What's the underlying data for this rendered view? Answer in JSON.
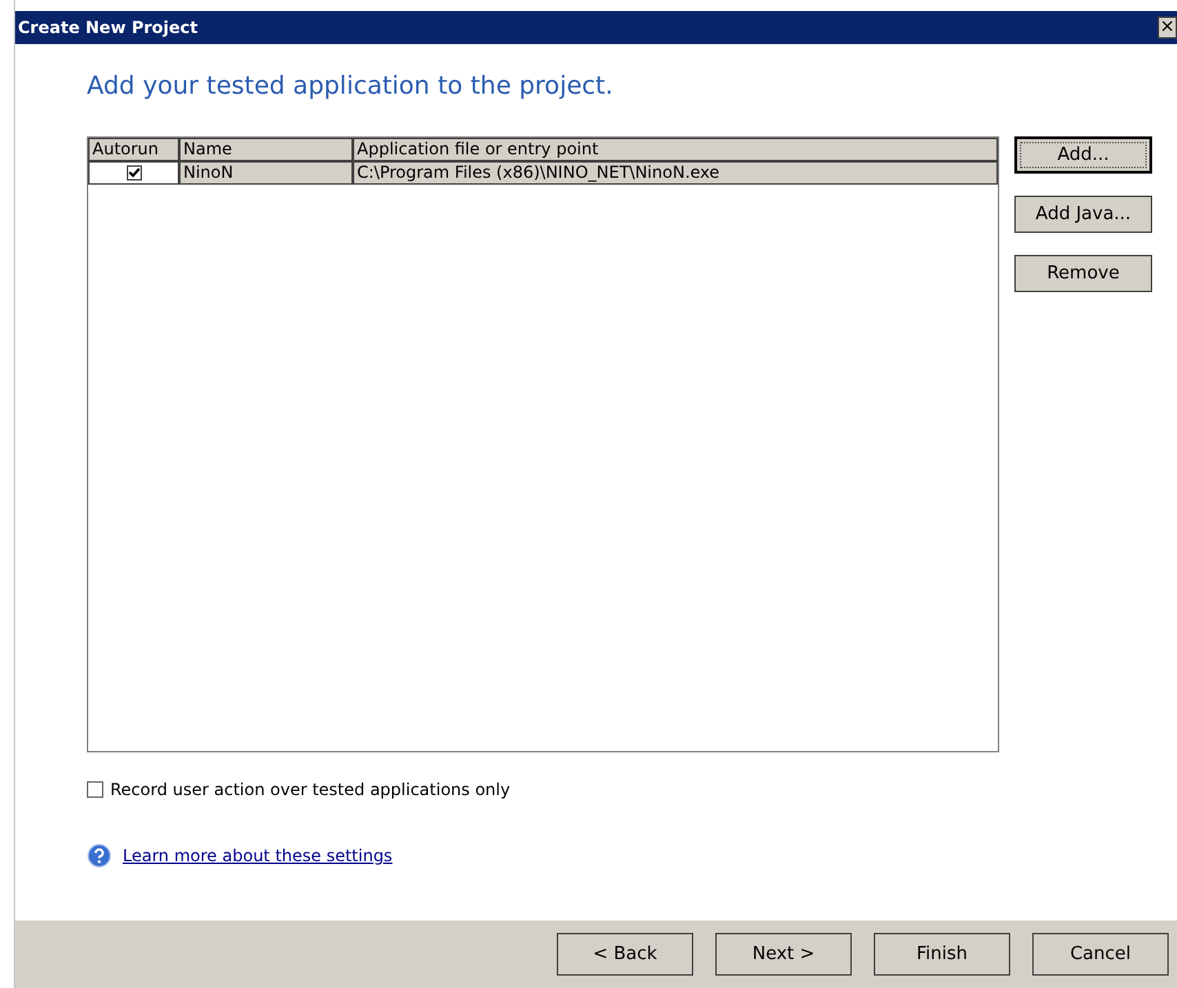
{
  "window": {
    "title": "Create New Project",
    "close": "×"
  },
  "heading": "Add your tested application to the project.",
  "table": {
    "columns": [
      "Autorun",
      "Name",
      "Application file or entry point"
    ],
    "rows": [
      {
        "autorun": true,
        "selected": true,
        "name": "NinoN",
        "path": "C:\\Program Files (x86)\\NINO_NET\\NinoN.exe"
      }
    ]
  },
  "side_buttons": [
    {
      "label": "Add...",
      "focused": true
    },
    {
      "label": "Add Java...",
      "focused": false
    },
    {
      "label": "Remove",
      "focused": false
    }
  ],
  "record_option": {
    "label": "Record user action over tested applications only",
    "checked": false
  },
  "help_link": "Learn more about these settings",
  "footer_buttons": [
    "< Back",
    "Next >",
    "Finish",
    "Cancel"
  ]
}
